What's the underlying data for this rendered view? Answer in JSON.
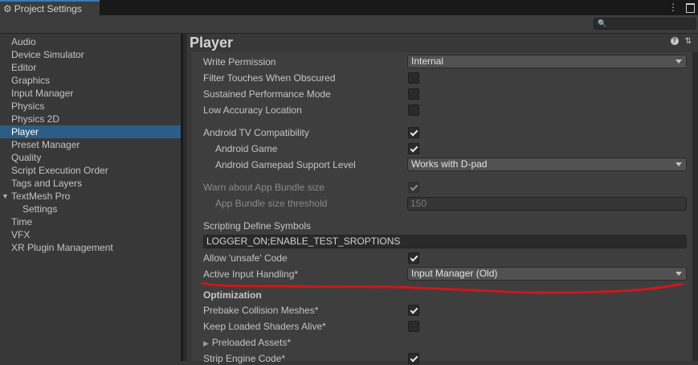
{
  "window": {
    "tab_title": "Project Settings",
    "icons": [
      "gear-icon",
      "kebab-menu-icon",
      "maximize-icon"
    ]
  },
  "search": {
    "placeholder": ""
  },
  "sidebar": {
    "items": [
      {
        "label": "Audio"
      },
      {
        "label": "Device Simulator"
      },
      {
        "label": "Editor"
      },
      {
        "label": "Graphics"
      },
      {
        "label": "Input Manager"
      },
      {
        "label": "Physics"
      },
      {
        "label": "Physics 2D"
      },
      {
        "label": "Player",
        "selected": true
      },
      {
        "label": "Preset Manager"
      },
      {
        "label": "Quality"
      },
      {
        "label": "Script Execution Order"
      },
      {
        "label": "Tags and Layers"
      },
      {
        "label": "TextMesh Pro",
        "expanded": true
      },
      {
        "label": "Settings",
        "child": true
      },
      {
        "label": "Time"
      },
      {
        "label": "VFX"
      },
      {
        "label": "XR Plugin Management"
      }
    ],
    "selected_color": "#2c5d87"
  },
  "header": {
    "title": "Player",
    "icons": [
      "help-icon",
      "preset-sliders-icon"
    ]
  },
  "settings": {
    "write_permission": {
      "label": "Write Permission",
      "value": "Internal"
    },
    "filter_touches": {
      "label": "Filter Touches When Obscured",
      "checked": false
    },
    "sustained_perf": {
      "label": "Sustained Performance Mode",
      "checked": false
    },
    "low_accuracy": {
      "label": "Low Accuracy Location",
      "checked": false
    },
    "android_tv": {
      "label": "Android TV Compatibility",
      "checked": true
    },
    "android_game": {
      "label": "Android Game",
      "checked": true
    },
    "gamepad_support": {
      "label": "Android Gamepad Support Level",
      "value": "Works with D-pad"
    },
    "warn_bundle": {
      "label": "Warn about App Bundle size",
      "checked": true
    },
    "bundle_threshold": {
      "label": "App Bundle size threshold",
      "value": "150"
    },
    "scripting_define": {
      "label": "Scripting Define Symbols",
      "value": "LOGGER_ON;ENABLE_TEST_SROPTIONS"
    },
    "allow_unsafe": {
      "label": "Allow 'unsafe' Code",
      "checked": true
    },
    "active_input": {
      "label": "Active Input Handling*",
      "value": "Input Manager (Old)"
    },
    "optimization": {
      "label": "Optimization"
    },
    "prebake": {
      "label": "Prebake Collision Meshes*",
      "checked": true
    },
    "keep_shaders": {
      "label": "Keep Loaded Shaders Alive*",
      "checked": false
    },
    "preloaded_assets": {
      "label": "Preloaded Assets*"
    },
    "strip_engine": {
      "label": "Strip Engine Code*",
      "checked": true
    }
  },
  "annotation": {
    "color": "#d0161b"
  }
}
